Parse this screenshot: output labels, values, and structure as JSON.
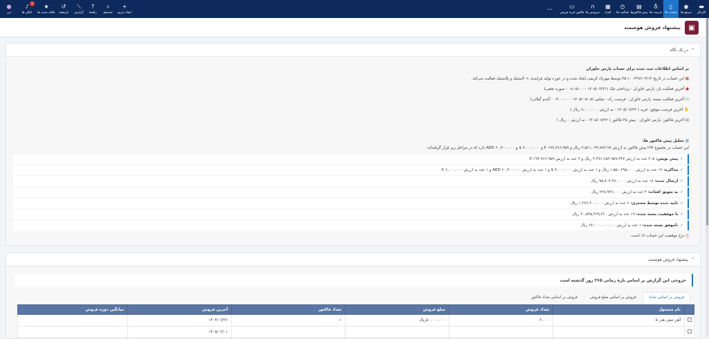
{
  "nav_right": [
    {
      "label": "کارتابل",
      "icon": "dashboard-icon"
    },
    {
      "label": "سرفع ها",
      "icon": "compass-icon"
    },
    {
      "label": "حساب ها",
      "icon": "mobile-icon"
    },
    {
      "label": "فرصت ها",
      "icon": "lightbulb-icon"
    },
    {
      "label": "پیش فاکتورها",
      "icon": "file-icon"
    },
    {
      "label": "فعالیت ها",
      "icon": "clock-icon"
    },
    {
      "label": "افراد",
      "icon": "users-icon"
    },
    {
      "label": "سرویس ها",
      "icon": "headset-icon"
    },
    {
      "label": "فاکتور خرید فروش",
      "icon": "document-icon"
    }
  ],
  "nav_more": "...",
  "nav_left": [
    {
      "label": "ایجاد سریع",
      "icon": "plus-icon"
    },
    {
      "label": "جستجو",
      "icon": "search-icon"
    },
    {
      "label": "راهنما",
      "icon": "help-icon"
    },
    {
      "label": "گزارش",
      "icon": "chart-icon"
    },
    {
      "label": "تاریخچه",
      "icon": "history-icon"
    },
    {
      "label": "علاقه مندی ها",
      "icon": "star-icon"
    },
    {
      "label": "اعلان ها",
      "icon": "bell-icon",
      "badge": "۲"
    },
    {
      "label": "من",
      "icon": "avatar-icon"
    }
  ],
  "page_title": "پیشنهاد فروش هوشمند",
  "glance": {
    "title": "در یک نگاه",
    "intro": "بر اساس اطلاعات ثبت شده برای حساب پارس خاوران",
    "created": "این حساب در تاریخ ۱۳۹۶/۰۴/۱۴ ۲۵:۱۰ توسط مهرداد کریمی ایجاد شده و در حوزه تولید فرایندی > لاستیک و پلاستیک فعالیت می‌کند.",
    "last_open": "آخرین فعالیت باز: پارس خاوران - پرداختی چک (۱۴۰۵/۰۴/۳۱ - ۰۸:۱۵:۰۰ - سوره تخفی)",
    "last_closed": "آخرین فعالیت بسته: پارس خاوران - فرصت رک - تماس (۱۴۰۵/۰۸/۰۵ - ۰۴:۰۰:۰۰ - گندم گیلانی)",
    "last_deal": "آخرین فرصت موفق: خرید ( ۱۴۰۵/۰۷/۲۳ - به ارزش ۹,۰۰۰,۰۰۰ ریال )",
    "last_invoice": "آخرین فاکتور: پارس خاوران - پیش ۲۵ فاکتور ( ۱۴۰۵/۰۷/۲۲ - به ارزش ۰ ریال )",
    "analysis_title": "تحلیل پیش فاکتور ها:",
    "analysis_text": "این حساب در مجموع ۲۷۴ پیش فاکتور به ارزش ۳,۵۶۱,۰۴۹,۷۸۲,۹۷ ریال و ۱۹۹,۷۶۶,۹۵۹ € و ۳,۰۰۰,۰۰۰ $ و AED ۶۰,۴۰۰,۰۰۰ دارد که در مراحل زیر قرار گرفته‌اند:",
    "stages": [
      {
        "label": "پیش نویس:",
        "text": "۲۰۵ عدد به ارزش ۳,۳۷۶,۶۵۳,۹۵۹,۳۳۷ ریال و ۴ عدد به ارزش ۱۹۴,۷۶۶,۹۵۹ €"
      },
      {
        "label": "مذاکره:",
        "text": "۱۲ عدد به ارزش ۱,۵۵۰,۲۹۵,۰۰۰ ریال و ۱ عدد به ارزش ۳,۰۰۰,۰۰۰ $ و ۱ عدد به ارزش AED ۶۰,۴۰۰,۰۰۰ و ۱ عدد به ارزش ۶,۰۰۰,۰۰۰ €"
      },
      {
        "label": "ارسال شده:",
        "text": "۱۸ عدد به ارزش ۹۵,۸۰۴,۳۸۰,۰۰۰ ریال"
      },
      {
        "label": "به تعویق افتاده:",
        "text": "۴ عدد به ارزش ۲۲۸,۹۴۶,۰۰۰ ریال"
      },
      {
        "label": "تایید شده توسط مشتری:",
        "text": "۶ عدد به ارزش ۱,۲۷۶,۲۰۰,۰۰۰ ریال"
      },
      {
        "label": "با موفقیت بسته شده:",
        "text": "۱۹ عدد به ارزش ۲۰,۵۳۵,۳۶۹,۲۶۰ ریال"
      },
      {
        "label": "ناموفق بسته شده:",
        "text": "۱ عدد به ارزش ۶۳,۰۰۰,۰۰۰,۰۰۰ ریال"
      }
    ],
    "success_rate": "نرخ موفقیت این حساب ۷٪ است."
  },
  "smart": {
    "title": "پیشنهاد فروش هوشمند",
    "export_note": "خروجی این گزارش بر اساس بازه زمانی ۳۶۵ روز گذشته است",
    "tabs": [
      "فروش بر اساس تعداد",
      "فروش بر اساس مبلغ فروش",
      "فروش بر اساس تعداد فاکتور"
    ],
    "columns": [
      "",
      "نام محصول",
      "تعداد فروش",
      "مبلغ فروش",
      "تعداد فاکتور",
      "آخرین فروش",
      "میانگین دوره فروش"
    ],
    "rows": [
      {
        "product": "آهن تیغی هدر ۵",
        "qty": "۲,۰۰۰",
        "amount": "۵۰,۰۰۰,۰۰۰ریال",
        "invoices": "۱",
        "last": "۱۴۰۴/۰۷/۲۶",
        "avg": "۰"
      },
      {
        "product": "",
        "qty": "",
        "amount": "",
        "invoices": "",
        "last": "۱۴۰۵/۰۲/۰۱",
        "avg": ""
      }
    ]
  }
}
